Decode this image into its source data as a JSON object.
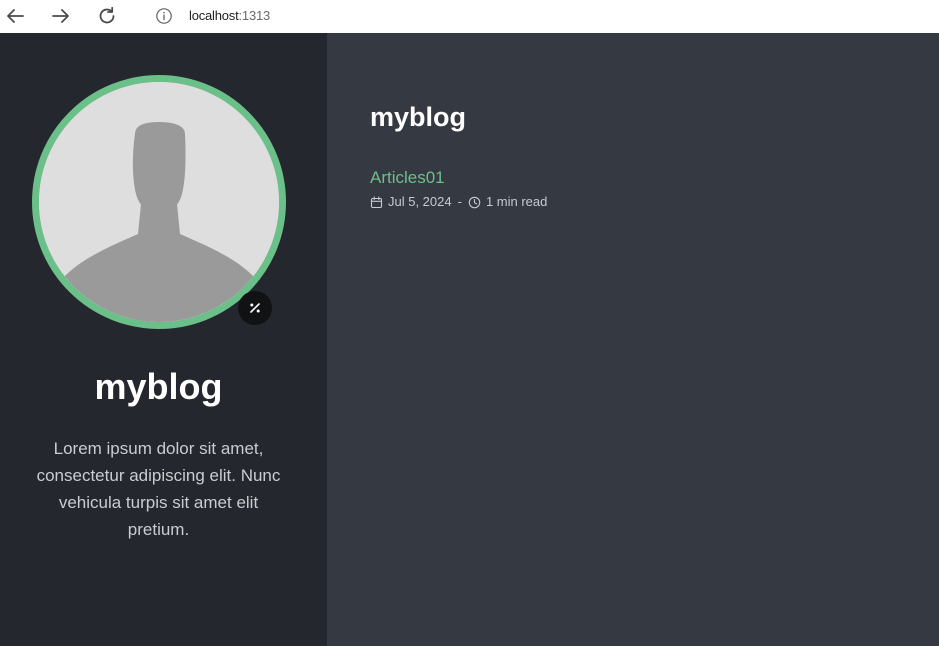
{
  "browser": {
    "url_host": "localhost",
    "url_port": ":1313",
    "icons": [
      "back-arrow-icon",
      "forward-arrow-icon",
      "reload-icon",
      "info-icon"
    ]
  },
  "sidebar": {
    "title": "myblog",
    "description": "Lorem ipsum dolor sit amet, consectetur adipiscing elit. Nunc vehicula turpis sit amet elit pretium.",
    "icons": [
      "default-avatar-icon",
      "theme-toggle-icon"
    ]
  },
  "main": {
    "title": "myblog",
    "articles": [
      {
        "title": "Articles01",
        "date": "Jul 5, 2024",
        "separator": "-",
        "read_time": "1 min read",
        "icons": [
          "calendar-icon",
          "clock-icon"
        ]
      }
    ]
  },
  "colors": {
    "sidebar_bg": "#24272d",
    "main_bg": "#353941",
    "accent": "#6fbe8a",
    "avatar_ring": "#6bbf88",
    "text_primary": "#ffffff",
    "text_secondary": "#c7cad0"
  }
}
